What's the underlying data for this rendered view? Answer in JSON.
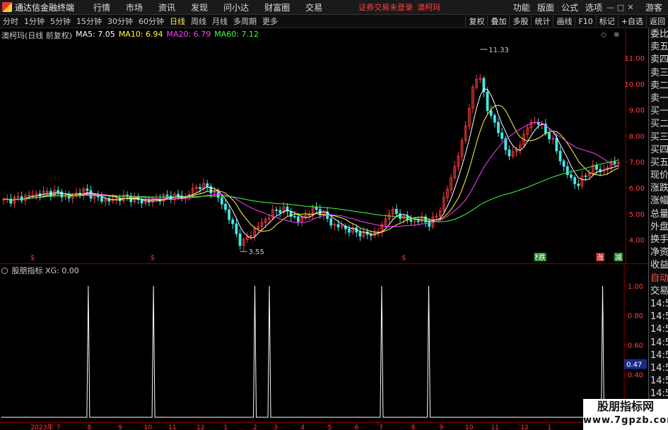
{
  "app": {
    "title": "通达信金融终端"
  },
  "menu": [
    "行情",
    "市场",
    "资讯",
    "发现",
    "问小达",
    "财富圈",
    "交易"
  ],
  "notice": {
    "text": "证券交易未登录",
    "stock": "澳柯玛"
  },
  "right_menu": [
    "功能",
    "版面",
    "公式",
    "选项"
  ],
  "guest": "游客",
  "periods": [
    {
      "label": "分时",
      "active": false
    },
    {
      "label": "1分钟",
      "active": false
    },
    {
      "label": "5分钟",
      "active": false
    },
    {
      "label": "15分钟",
      "active": false
    },
    {
      "label": "30分钟",
      "active": false
    },
    {
      "label": "60分钟",
      "active": false
    },
    {
      "label": "日线",
      "active": true
    },
    {
      "label": "周线",
      "active": false
    },
    {
      "label": "月线",
      "active": false
    },
    {
      "label": "多周期",
      "active": false
    },
    {
      "label": "更多",
      "active": false
    }
  ],
  "tools": [
    "复权",
    "叠加",
    "多股",
    "统计",
    "画线",
    "F10",
    "标记",
    "+自选",
    "返回"
  ],
  "main_legend": {
    "stock": "澳柯玛(日线 前复权)",
    "ma5": "MA5: 7.05",
    "ma10": "MA10: 6.94",
    "ma20": "MA20: 6.79",
    "ma60": "MA60: 7.12"
  },
  "sub_legend": {
    "name": "股朋指标",
    "value": "XG: 0.00"
  },
  "side_panel": {
    "items": [
      "委比",
      "卖五",
      "卖四",
      "卖三",
      "卖二",
      "卖一",
      "买一",
      "买二",
      "买三",
      "买四",
      "买五",
      "现价",
      "涨跌",
      "涨幅",
      "总量",
      "外盘",
      "换手",
      "净资",
      "收益",
      "自动",
      "交易",
      "14:56",
      "14:56",
      "14:56",
      "14:56",
      "14:56",
      "14:56",
      "14:56",
      "14:56",
      "14:56"
    ]
  },
  "chart_data": [
    {
      "type": "candlestick",
      "title": "澳柯玛(日线 前复权)",
      "ylim": [
        3.5,
        11.6
      ],
      "y_ticks": [
        "11.00",
        "10.00",
        "9.00",
        "8.00",
        "7.00",
        "6.00",
        "5.00",
        "4.00"
      ],
      "x_ticks": [
        "2023年",
        "7",
        "8",
        "9",
        "10",
        "11",
        "12",
        "1",
        "2",
        "3",
        "4",
        "5",
        "6",
        "7",
        "8",
        "9",
        "10",
        "11",
        "12",
        "1"
      ],
      "annotations": [
        {
          "text": "11.33",
          "value": 11.33
        },
        {
          "text": "3.55",
          "value": 3.55
        }
      ],
      "markers": [
        "$",
        "$",
        "$",
        "榜",
        "跌",
        "涨",
        "预",
        "减"
      ],
      "close_path": [
        5.5,
        5.55,
        5.6,
        5.7,
        5.75,
        5.8,
        5.85,
        5.75,
        5.6,
        5.8,
        5.9,
        5.65,
        5.55,
        5.5,
        5.6,
        5.65,
        5.55,
        5.45,
        5.5,
        5.6,
        5.65,
        5.7,
        5.6,
        5.9,
        6.1,
        6.0,
        5.7,
        5.2,
        4.5,
        3.8,
        4.2,
        4.5,
        4.8,
        5.1,
        5.2,
        5.0,
        4.7,
        5.0,
        5.2,
        5.0,
        4.6,
        4.5,
        4.4,
        4.3,
        4.2,
        4.2,
        4.4,
        5.1,
        5.0,
        4.8,
        4.7,
        4.8,
        4.6,
        5.0,
        5.8,
        6.8,
        7.8,
        9.5,
        10.5,
        9.0,
        8.5,
        7.6,
        7.2,
        7.7,
        8.4,
        8.6,
        8.2,
        7.8,
        7.0,
        6.4,
        6.1,
        6.5,
        6.8,
        6.6,
        6.9,
        7.05
      ]
    },
    {
      "type": "line",
      "title": "股朋指标",
      "ylim": [
        0.1,
        1.1
      ],
      "y_ticks": [
        "1.00",
        "0.80",
        "0.60",
        "0.40",
        "0.20"
      ],
      "current_label": "0.47",
      "spikes_at_day": [
        23,
        41,
        69,
        73,
        104,
        117,
        165
      ],
      "series": [
        {
          "name": "XG",
          "value": 0.0
        }
      ]
    }
  ],
  "watermark": {
    "title": "股朋指标网",
    "url": "www.7gpzb.com"
  }
}
